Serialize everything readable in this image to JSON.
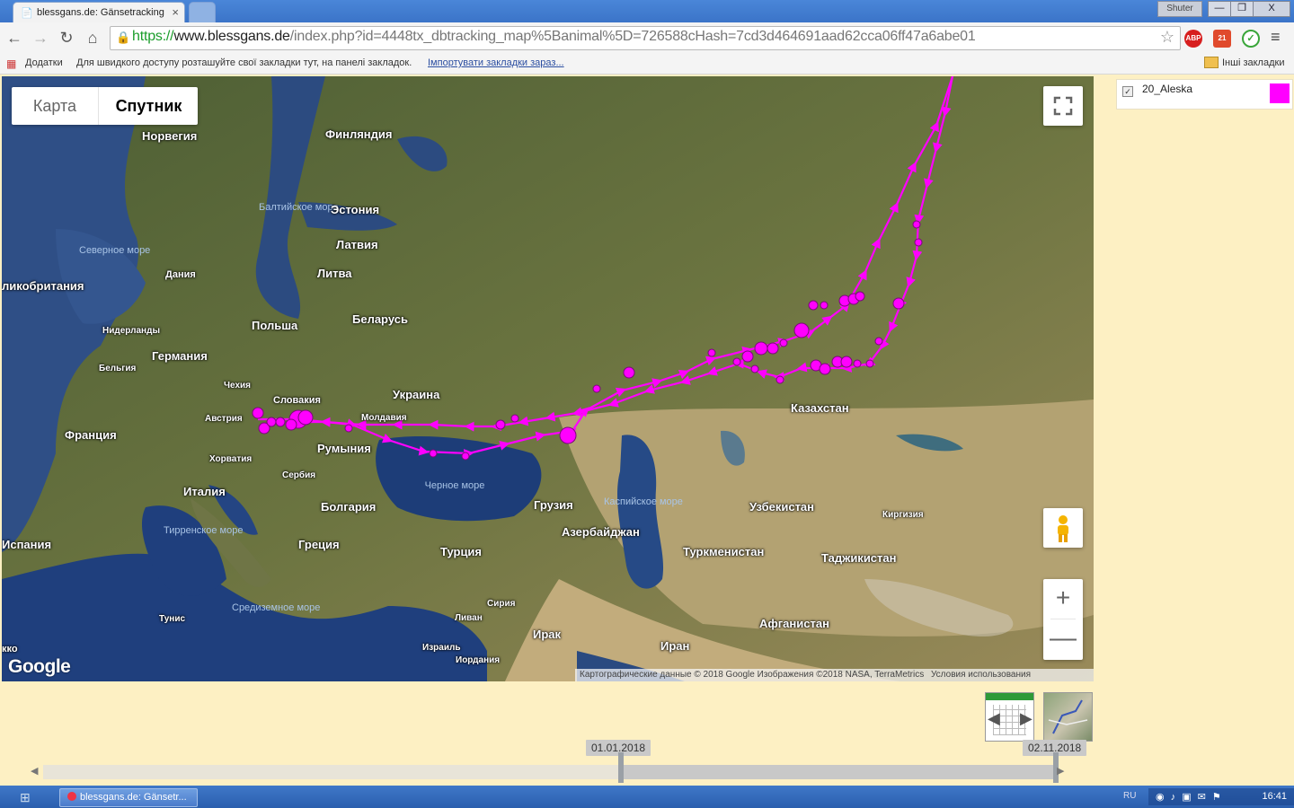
{
  "browser": {
    "tab_title": "blessgans.de: Gänsetracking",
    "tab_close": "×",
    "window_user": "Shuter",
    "window_min": "—",
    "window_max": "❐",
    "window_close": "X",
    "url_scheme": "https://",
    "url_host": "www.blessgans.de",
    "url_path": "/index.php?id=4448tx_dbtracking_map%5Banimal%5D=726588cHash=7cd3d464691aad62cca06ff47a6abe01",
    "ext_abp": "ABP",
    "ext_badge": "21",
    "menu_glyph": "≡"
  },
  "bookmarks": {
    "apps_label": "Додатки",
    "hint": "Для швидкого доступу розташуйте свої закладки тут, на панелі закладок.",
    "import_link": "Імпортувати закладки зараз...",
    "other": "Інші закладки"
  },
  "map": {
    "type_options": [
      "Карта",
      "Спутник"
    ],
    "selected_type": "Спутник",
    "zoom_in": "+",
    "zoom_out": "—",
    "logo": "Google",
    "attribution_data": "Картографические данные © 2018 Google Изображения ©2018 NASA, TerraMetrics",
    "attribution_terms": "Условия использования",
    "track_color": "#ff00ff",
    "labels": {
      "norway": "Норвегия",
      "finland": "Финляндия",
      "baltic_sea": "Балтийское море",
      "estonia": "Эстония",
      "latvia": "Латвия",
      "lithuania": "Литва",
      "north_sea": "Северное море",
      "denmark": "Дания",
      "britain": "ликобритания",
      "poland": "Польша",
      "belarus": "Беларусь",
      "netherlands": "Нидерланды",
      "germany": "Германия",
      "belgium": "Бельгия",
      "czechia": "Чехия",
      "slovakia": "Словакия",
      "ukraine": "Украина",
      "austria": "Австрия",
      "moldova": "Молдавия",
      "france": "Франция",
      "romania": "Румыния",
      "croatia": "Хорватия",
      "serbia": "Сербия",
      "italy": "Италия",
      "black_sea": "Черное море",
      "bulgaria": "Болгария",
      "georgia": "Грузия",
      "caspian_sea": "Каспийское море",
      "spain": "Испания",
      "tyrrhenian_sea": "Тирренское море",
      "greece": "Греция",
      "azerbaijan": "Азербайджан",
      "turkey": "Турция",
      "kazakhstan": "Казахстан",
      "uzbekistan": "Узбекистан",
      "kyrgyzstan": "Киргизия",
      "turkmenistan": "Туркменистан",
      "tajikistan": "Таджикистан",
      "tunisia": "Тунис",
      "mediterranean": "Средиземное море",
      "syria": "Сирия",
      "lebanon": "Ливан",
      "iraq": "Ирак",
      "israel": "Израиль",
      "jordan": "Иордания",
      "iran": "Иран",
      "afghanistan": "Афганистан",
      "morocco": "кко"
    }
  },
  "legend": {
    "checked": true,
    "check_glyph": "✓",
    "animal": "20_Aleska",
    "color": "#ff00ff"
  },
  "timeline": {
    "start_date": "01.01.2018",
    "end_date": "02.11.2018",
    "selected_from_fraction": 0.0,
    "selected_to_fraction": 1.0
  },
  "taskbar": {
    "task_label": "blessgans.de: Gänsetr...",
    "language": "RU",
    "clock": "16:41"
  }
}
